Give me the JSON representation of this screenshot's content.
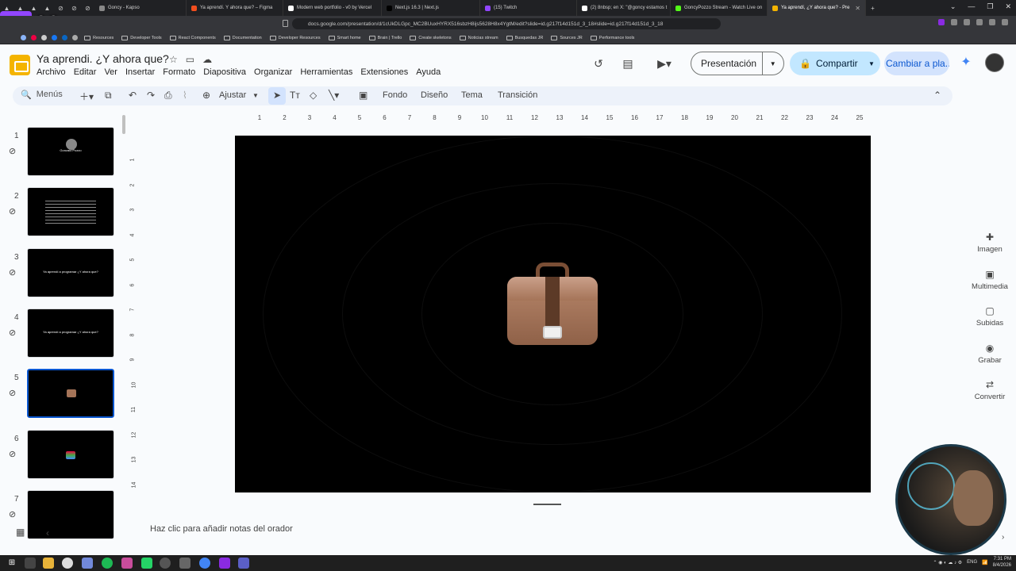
{
  "browser": {
    "pinned_tabs": [
      "▲",
      "▲",
      "▲",
      "▲",
      "⊘",
      "⊘",
      "⊘"
    ],
    "tabs": [
      {
        "label": "Goncy - Kapso",
        "icon_color": "#888888",
        "active": false
      },
      {
        "label": "Ya aprendí. Y ahora que? – Figma",
        "icon_color": "#f24e1e",
        "active": false
      },
      {
        "label": "Modern web portfolio - v0 by Vercel",
        "icon_color": "#ffffff",
        "active": false
      },
      {
        "label": "Next.js 16.3 | Next.js",
        "icon_color": "#000000",
        "active": false
      },
      {
        "label": "(15) Twitch",
        "icon_color": "#9146ff",
        "active": false
      },
      {
        "label": "(2) 8nbsp; en X: \"@goncy estamos t",
        "icon_color": "#ffffff",
        "active": false
      },
      {
        "label": "GoncyPozzo Stream - Watch Live on",
        "icon_color": "#53fc18",
        "active": false
      },
      {
        "label": "Ya aprendí, ¿Y ahora que? - Pre",
        "icon_color": "#f4b400",
        "active": true
      }
    ],
    "url": "docs.google.com/presentation/d/1cUkDLGpc_MC2BUuxHYRX516sbzH8ijs5628H8x4YgtM/edit?slide=id.g217f14d151d_3_18#slide=id.g217f14d151d_3_18",
    "bookmarks": [
      "Resources",
      "Developer Tools",
      "React Components",
      "Documentation",
      "Developer Resources",
      "Smart home",
      "Brain | Trello",
      "Create skeletons",
      "Noticias stream",
      "Busquedas JR",
      "Sources JR",
      "Performance tools"
    ],
    "twitch_count": "92"
  },
  "app": {
    "title": "Ya aprendi. ¿Y ahora que?",
    "menu": [
      "Archivo",
      "Editar",
      "Ver",
      "Insertar",
      "Formato",
      "Diapositiva",
      "Organizar",
      "Herramientas",
      "Extensiones",
      "Ayuda"
    ],
    "present_label": "Presentación",
    "share_label": "Compartir",
    "switch_label": "Cambiar a pla..."
  },
  "toolbar": {
    "menus_label": "Menús",
    "zoom_label": "Ajustar",
    "background_label": "Fondo",
    "design_label": "Diseño",
    "theme_label": "Tema",
    "transition_label": "Transición"
  },
  "slides": [
    {
      "number": "1",
      "selected": false,
      "caption": "Gonzalo Pozzo"
    },
    {
      "number": "2",
      "selected": false,
      "caption": ""
    },
    {
      "number": "3",
      "selected": false,
      "caption": "Ya aprendí a programar ¿Y ahora que?"
    },
    {
      "number": "4",
      "selected": false,
      "caption": "Ya aprendí a programar ¿Y ahora que?"
    },
    {
      "number": "5",
      "selected": true,
      "caption": ""
    },
    {
      "number": "6",
      "selected": false,
      "caption": ""
    },
    {
      "number": "7",
      "selected": false,
      "caption": ""
    }
  ],
  "ruler_top": [
    "1",
    "2",
    "3",
    "4",
    "5",
    "6",
    "7",
    "8",
    "9",
    "10",
    "11",
    "12",
    "13",
    "14",
    "15",
    "16",
    "17",
    "18",
    "19",
    "20",
    "21",
    "22",
    "23",
    "24",
    "25"
  ],
  "ruler_left": [
    "1",
    "2",
    "3",
    "4",
    "5",
    "6",
    "7",
    "8",
    "9",
    "10",
    "11",
    "12",
    "13",
    "14"
  ],
  "notes": {
    "placeholder": "Haz clic para añadir notas del orador"
  },
  "side_panel": [
    "Imagen",
    "Multimedia",
    "Subidas",
    "Grabar",
    "Convertir"
  ],
  "taskbar": {
    "lang": "ENG",
    "time": "7:31 PM",
    "date": "8/4/2026"
  }
}
